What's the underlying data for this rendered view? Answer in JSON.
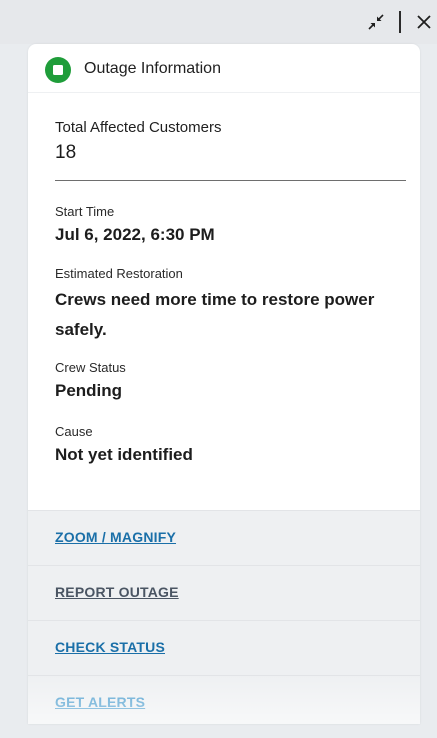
{
  "window": {
    "collapse_icon": "collapse-arrows-icon",
    "close_icon": "close-icon"
  },
  "panel": {
    "header": {
      "icon": "outage-status-square-icon",
      "icon_color": "#1f9d3a",
      "title": "Outage Information"
    },
    "total": {
      "label": "Total Affected Customers",
      "value": "18"
    },
    "fields": {
      "start_time": {
        "label": "Start Time",
        "value": "Jul 6, 2022, 6:30 PM"
      },
      "estimated_restoration": {
        "label": "Estimated Restoration",
        "value": "Crews need more time to restore power safely."
      },
      "crew_status": {
        "label": "Crew Status",
        "value": "Pending"
      },
      "cause": {
        "label": "Cause",
        "value": "Not yet identified"
      }
    },
    "actions": [
      {
        "label": "ZOOM / MAGNIFY",
        "color": "#1a6fa8"
      },
      {
        "label": "REPORT OUTAGE",
        "color": "#4a5563"
      },
      {
        "label": "CHECK STATUS",
        "color": "#1a6fa8"
      },
      {
        "label": "GET ALERTS",
        "color": "#4f9fcf"
      }
    ]
  }
}
